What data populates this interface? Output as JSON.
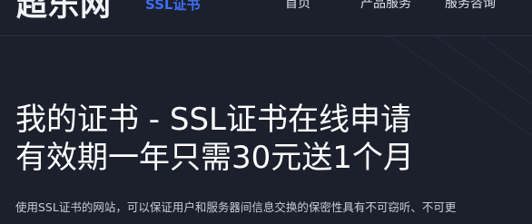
{
  "header": {
    "logo": "超乐网",
    "logo_sub": "SSL证书",
    "nav": [
      "首页",
      "产品服务",
      "服务咨询"
    ]
  },
  "hero": {
    "title_line1": "我的证书 - SSL证书在线申请",
    "title_line2": "有效期一年只需30元送1个月",
    "description": "使用SSL证书的网站，可以保证用户和服务器间信息交换的保密性具有不可窃听、不可更"
  },
  "colors": {
    "background": "#1c202d",
    "accent": "#3f6ef4",
    "text": "#ffffff"
  }
}
